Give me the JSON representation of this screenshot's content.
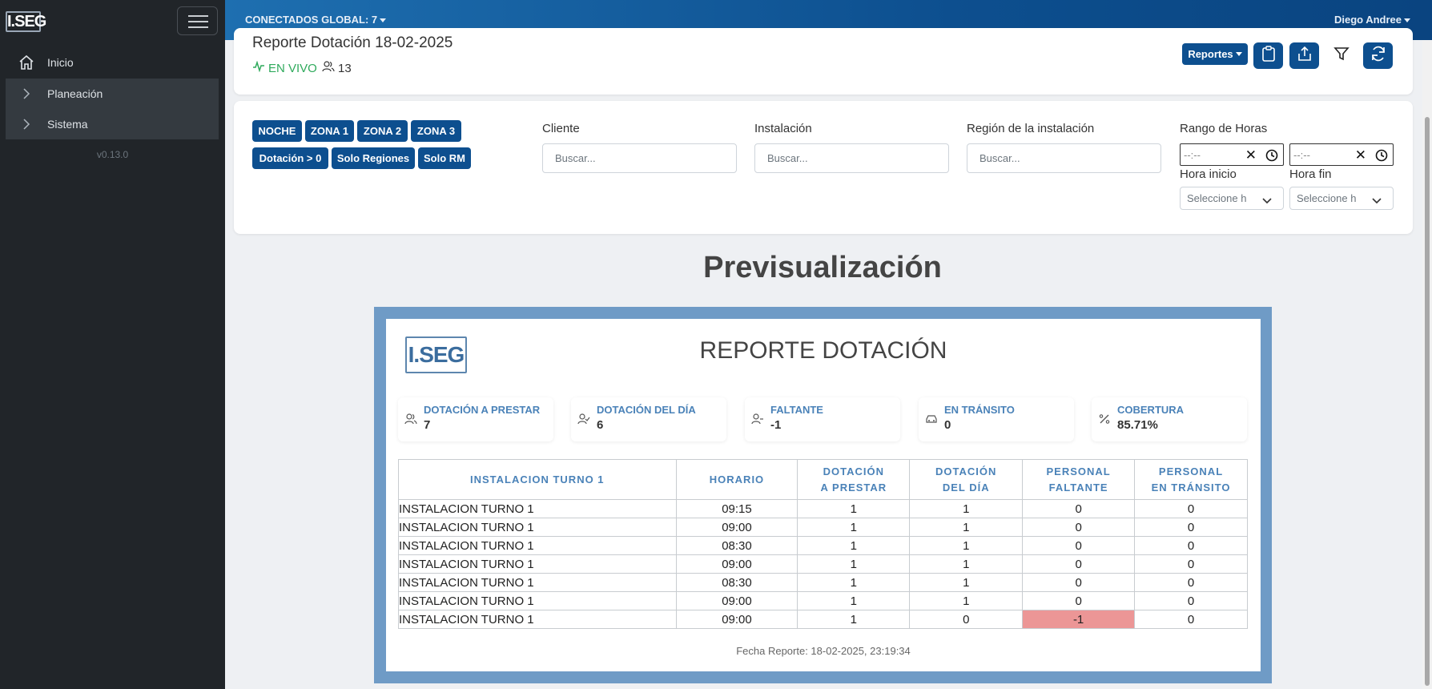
{
  "sidebar": {
    "logo": "I.SEG",
    "items": [
      {
        "label": "Inicio"
      },
      {
        "label": "Planeación"
      },
      {
        "label": "Sistema"
      }
    ],
    "version": "v0.13.0"
  },
  "topbar": {
    "connected": "CONECTADOS GLOBAL: 7",
    "user": "Diego Andree"
  },
  "header": {
    "title": "Reporte Dotación 18-02-2025",
    "live": "EN VIVO",
    "viewers": "13",
    "reports_button": "Reportes"
  },
  "filters": {
    "chips": [
      "NOCHE",
      "ZONA 1",
      "ZONA 2",
      "ZONA 3",
      "Dotación > 0",
      "Solo Regiones",
      "Solo RM"
    ],
    "cliente_label": "Cliente",
    "cliente_placeholder": "Buscar...",
    "instalacion_label": "Instalación",
    "instalacion_placeholder": "Buscar...",
    "region_label": "Región de la instalación",
    "region_placeholder": "Buscar...",
    "rango_label": "Rango de Horas",
    "time_placeholder": "--:--",
    "hora_inicio_label": "Hora inicio",
    "hora_fin_label": "Hora fin",
    "select_placeholder": "Seleccione h"
  },
  "preview": {
    "title": "Previsualización",
    "logo": "I.SEG",
    "report_title": "REPORTE DOTACIÓN",
    "kpis": [
      {
        "label": "DOTACIÓN A PRESTAR",
        "value": "7",
        "icon": "users-icon"
      },
      {
        "label": "DOTACIÓN DEL DÍA",
        "value": "6",
        "icon": "user-check-icon"
      },
      {
        "label": "FALTANTE",
        "value": "-1",
        "icon": "user-minus-icon"
      },
      {
        "label": "EN TRÁNSITO",
        "value": "0",
        "icon": "car-icon"
      },
      {
        "label": "COBERTURA",
        "value": "85.71%",
        "icon": "percent-icon"
      }
    ],
    "table": {
      "headers": [
        [
          "INSTALACION TURNO 1"
        ],
        [
          "HORARIO"
        ],
        [
          "DOTACIÓN",
          "A PRESTAR"
        ],
        [
          "DOTACIÓN",
          "DEL DÍA"
        ],
        [
          "PERSONAL",
          "FALTANTE"
        ],
        [
          "PERSONAL",
          "EN TRÁNSITO"
        ]
      ],
      "rows": [
        [
          "INSTALACION TURNO 1",
          "09:15",
          "1",
          "1",
          "0",
          "0"
        ],
        [
          "INSTALACION TURNO 1",
          "09:00",
          "1",
          "1",
          "0",
          "0"
        ],
        [
          "INSTALACION TURNO 1",
          "08:30",
          "1",
          "1",
          "0",
          "0"
        ],
        [
          "INSTALACION TURNO 1",
          "09:00",
          "1",
          "1",
          "0",
          "0"
        ],
        [
          "INSTALACION TURNO 1",
          "08:30",
          "1",
          "1",
          "0",
          "0"
        ],
        [
          "INSTALACION TURNO 1",
          "09:00",
          "1",
          "1",
          "0",
          "0"
        ],
        [
          "INSTALACION TURNO 1",
          "09:00",
          "1",
          "0",
          "-1",
          "0"
        ]
      ]
    },
    "footer": "Fecha Reporte: 18-02-2025, 23:19:34"
  },
  "colors": {
    "brand": "#0d4f8f",
    "sidebar": "#212529",
    "live": "#2faa5c",
    "shortage": "#ec9696",
    "frame": "#6f9bc6"
  }
}
